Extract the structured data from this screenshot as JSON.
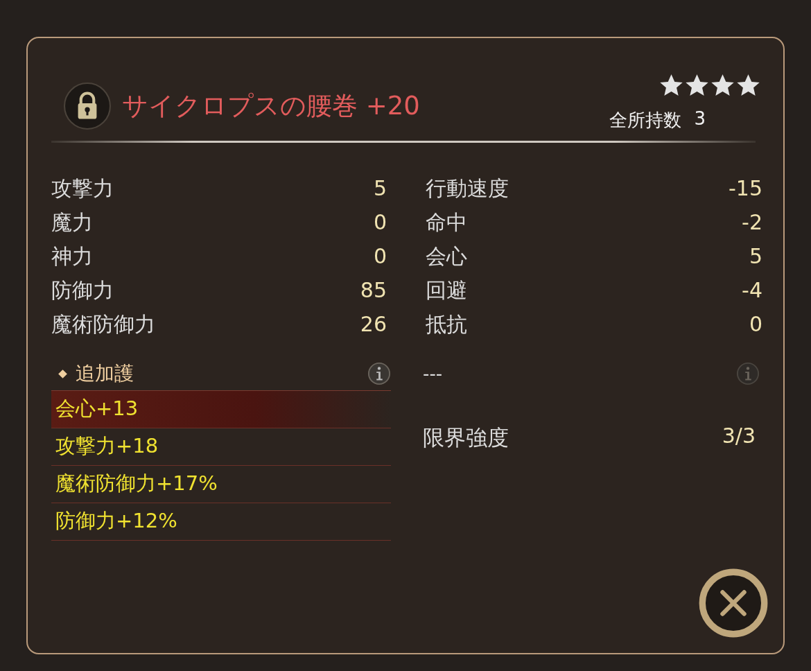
{
  "item": {
    "locked": true,
    "name": "サイクロプスの腰巻 +20",
    "stars": 4,
    "owned_label": "全所持数",
    "owned_count": "3"
  },
  "stats_left": [
    {
      "label": "攻撃力",
      "value": "5"
    },
    {
      "label": "魔力",
      "value": "0"
    },
    {
      "label": "神力",
      "value": "0"
    },
    {
      "label": "防御力",
      "value": "85"
    },
    {
      "label": "魔術防御力",
      "value": "26"
    }
  ],
  "stats_right": [
    {
      "label": "行動速度",
      "value": "-15"
    },
    {
      "label": "命中",
      "value": "-2"
    },
    {
      "label": "会心",
      "value": "5"
    },
    {
      "label": "回避",
      "value": "-4"
    },
    {
      "label": "抵抗",
      "value": "0"
    }
  ],
  "extra": {
    "title": "追加護",
    "bonuses": [
      {
        "text": "会心+13",
        "selected": true
      },
      {
        "text": "攻撃力+18",
        "selected": false
      },
      {
        "text": "魔術防御力+17%",
        "selected": false
      },
      {
        "text": "防御力+12%",
        "selected": false
      }
    ]
  },
  "extra_right": {
    "text": "---"
  },
  "limit": {
    "label": "限界強度",
    "value": "3/3"
  }
}
